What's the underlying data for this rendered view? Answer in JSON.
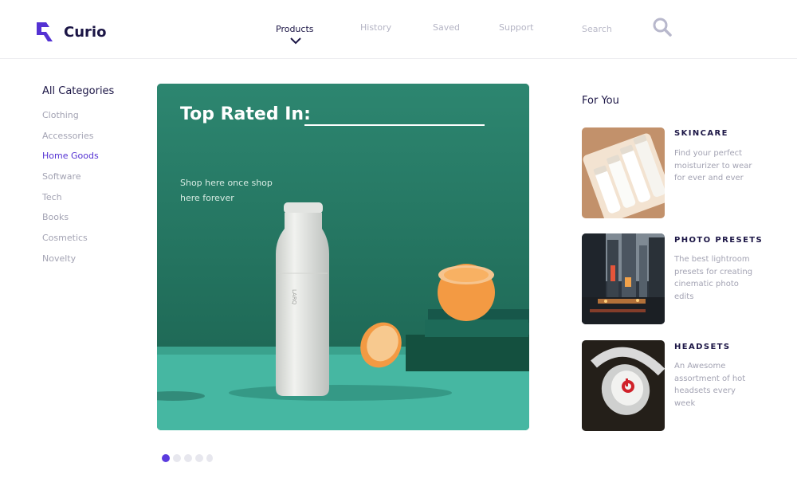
{
  "brand": {
    "name": "Curio",
    "color": "#5432d3"
  },
  "nav": {
    "items": [
      {
        "label": "Products",
        "active": true
      },
      {
        "label": "History"
      },
      {
        "label": "Saved"
      },
      {
        "label": "Support"
      }
    ],
    "search_placeholder": "Search"
  },
  "sidebar": {
    "title": "All Categories",
    "items": [
      "Clothing",
      "Accessories",
      "Home Goods",
      "Software",
      "Tech",
      "Books",
      "Cosmetics",
      "Novelty"
    ],
    "active_item": "Home Goods"
  },
  "hero": {
    "title": "Top Rated In:",
    "subtitle": "Shop here once shop here forever",
    "bottle_brand": "LARQ",
    "carousel": {
      "total": 5,
      "active_index": 0
    }
  },
  "for_you": {
    "title": "For You",
    "cards": [
      {
        "title": "SKINCARE",
        "description": "Find your perfect moisturizer to wear for ever and ever",
        "image_icon": "skincare-bottles-image"
      },
      {
        "title": "PHOTO PRESETS",
        "description": "The best lightroom presets for creating cinematic photo edits",
        "image_icon": "city-night-street-image"
      },
      {
        "title": "HEADSETS",
        "description": "An Awesome assortment of hot headsets every week",
        "image_icon": "headphones-image"
      }
    ]
  },
  "colors": {
    "primary_text": "#1c1646",
    "muted_text": "#a3a3b3",
    "accent": "#5432d3",
    "hero_bg": "#2a7b66"
  }
}
